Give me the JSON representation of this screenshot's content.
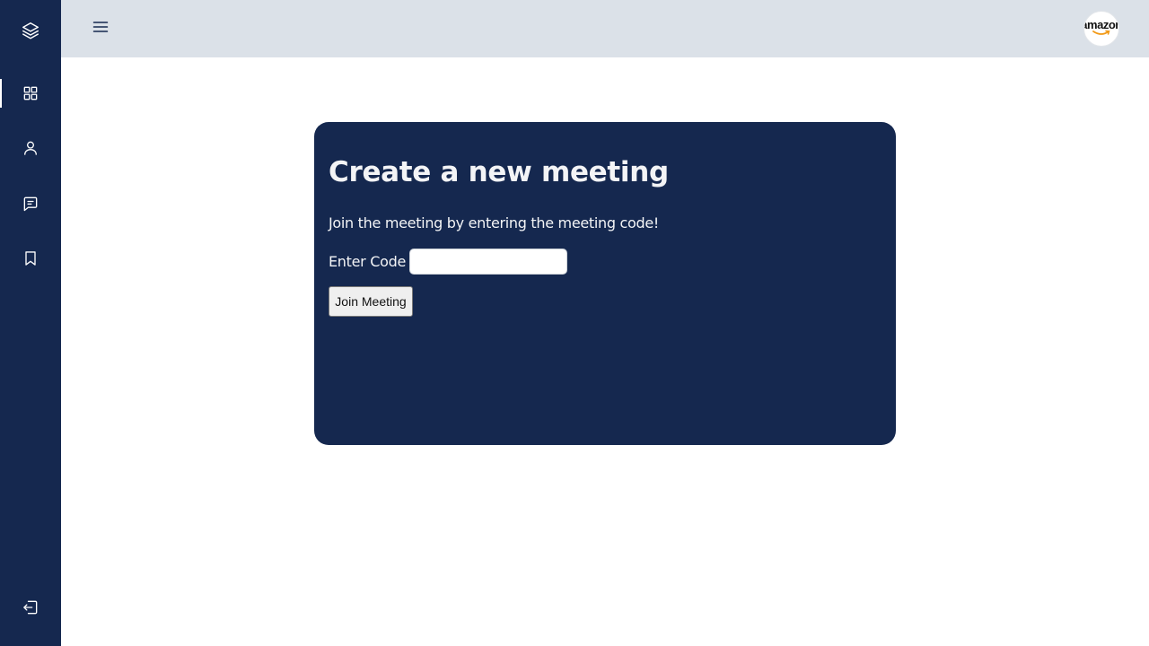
{
  "sidebar": {
    "logo_icon": "layers-icon",
    "items": [
      {
        "name": "dashboard",
        "icon": "grid-icon",
        "active": true
      },
      {
        "name": "profile",
        "icon": "user-icon",
        "active": false
      },
      {
        "name": "messages",
        "icon": "message-icon",
        "active": false
      },
      {
        "name": "bookmarks",
        "icon": "bookmark-icon",
        "active": false
      }
    ],
    "logout_icon": "logout-icon"
  },
  "header": {
    "menu_icon": "hamburger-menu-icon",
    "avatar_text": "amazon"
  },
  "card": {
    "title": "Create a new meeting",
    "description": "Join the meeting by entering the meeting code!",
    "code_label": "Enter Code",
    "code_value": "",
    "join_label": "Join Meeting"
  },
  "colors": {
    "sidebar_bg": "#15284f",
    "topbar_bg": "#dbe1e8",
    "card_bg": "#15284f",
    "text_light": "#f3f4f6",
    "avatar_smile": "#f29a17"
  }
}
